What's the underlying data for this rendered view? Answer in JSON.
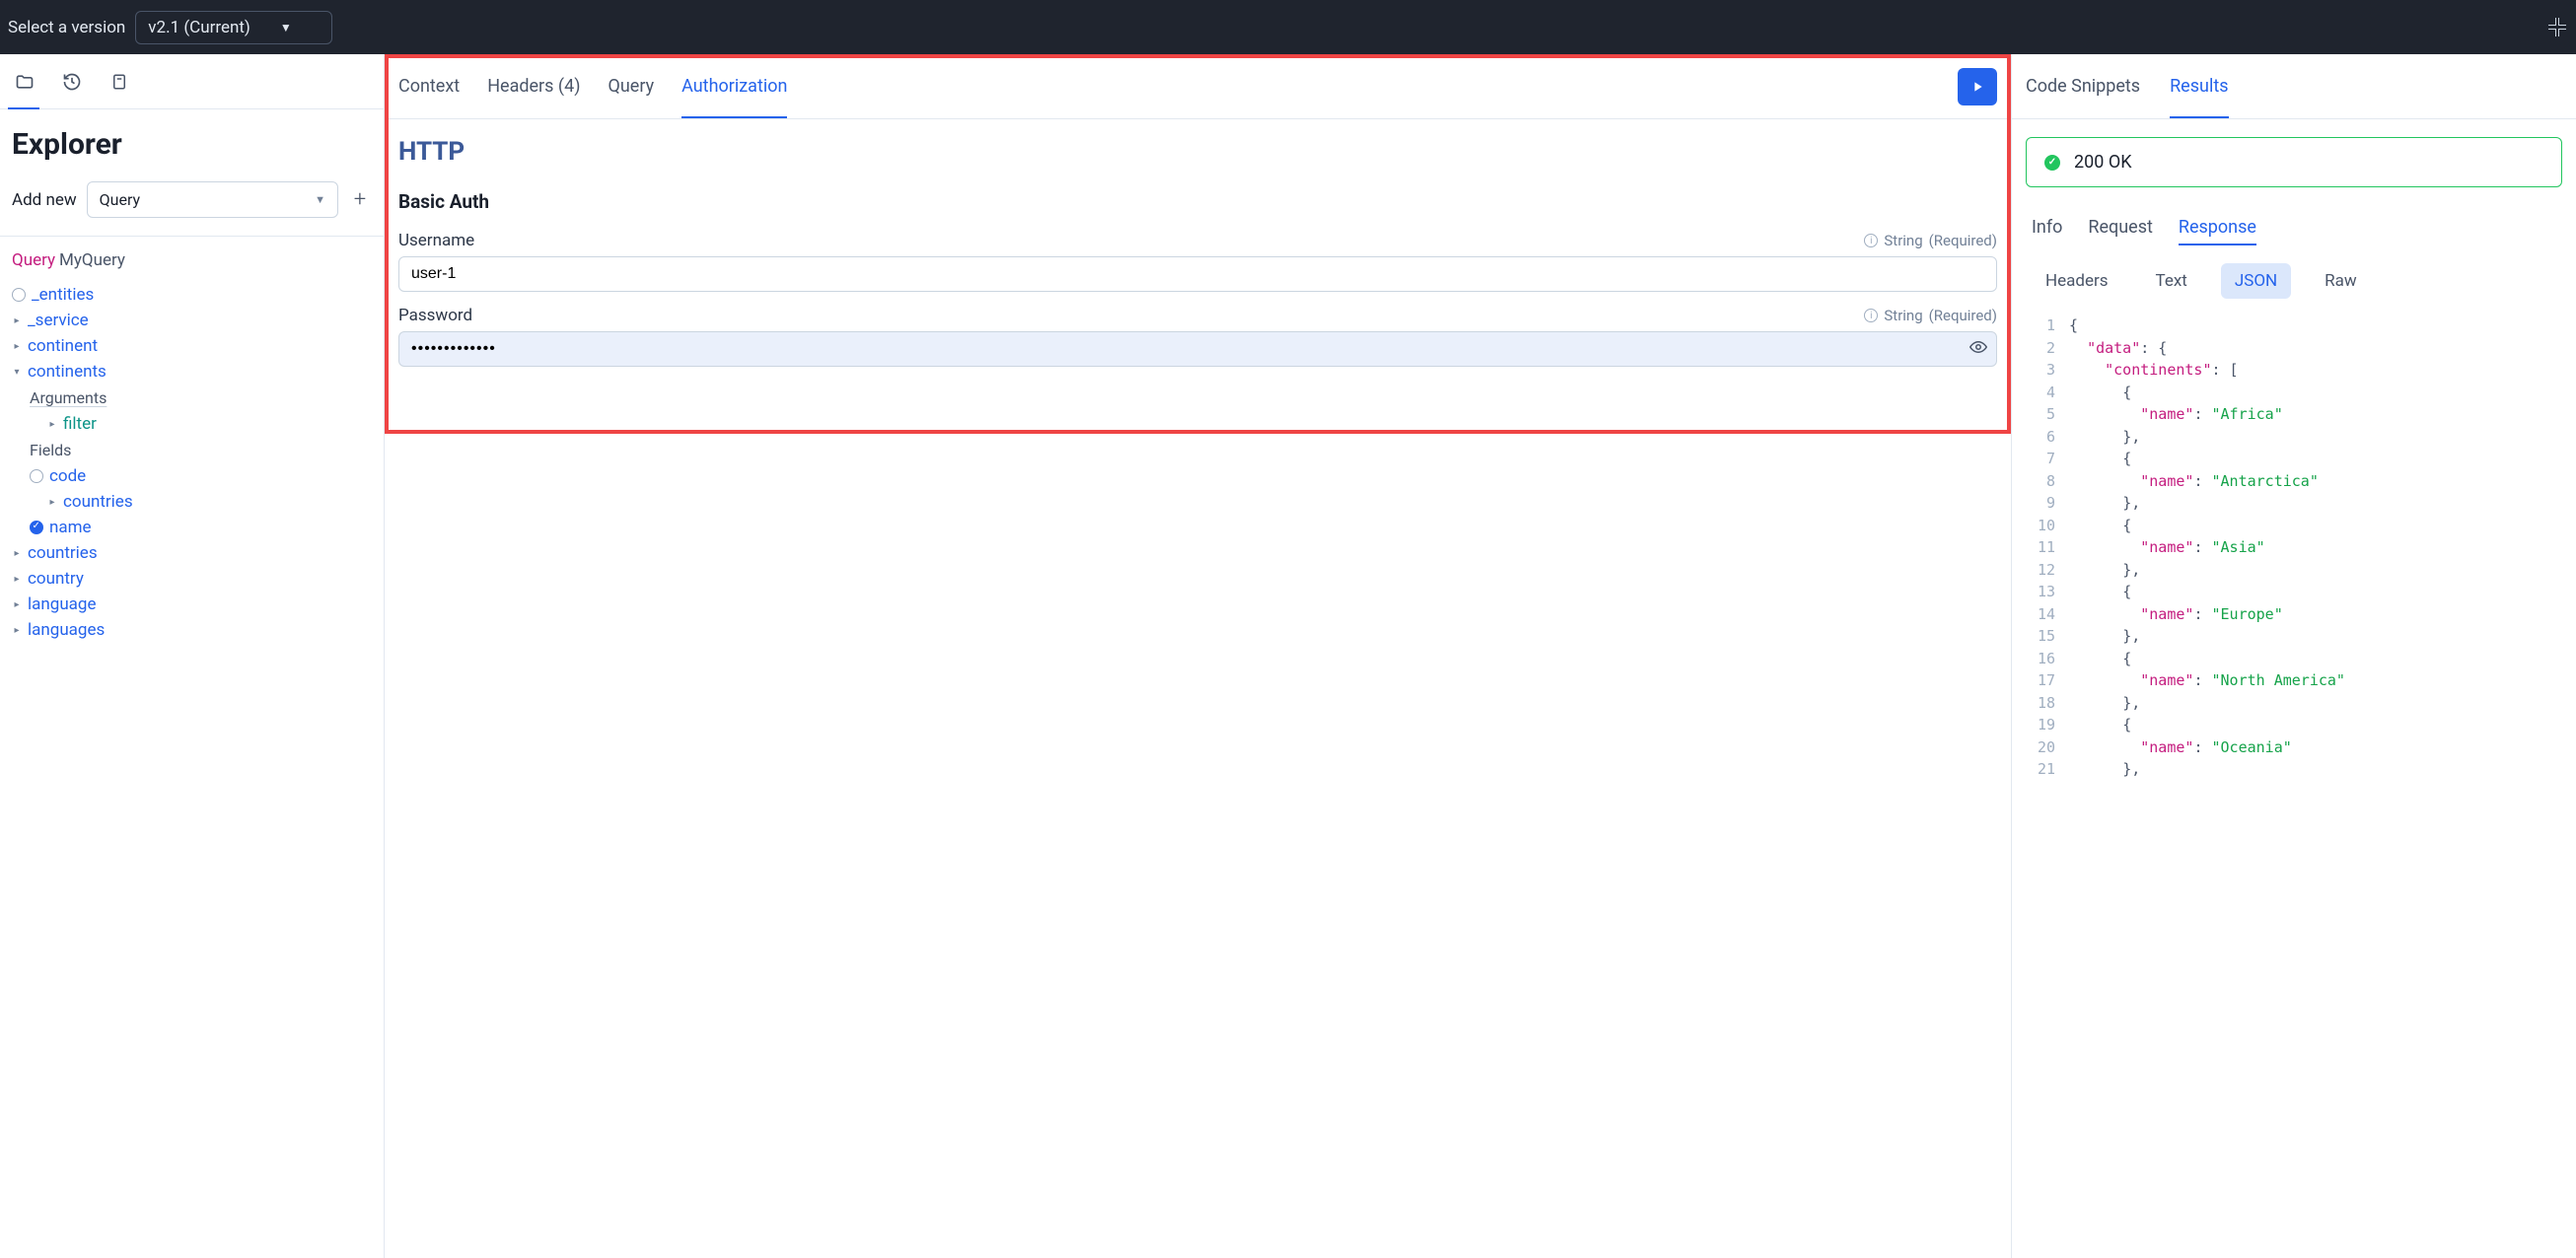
{
  "topbar": {
    "label": "Select a version",
    "version": "v2.1 (Current)"
  },
  "left": {
    "title": "Explorer",
    "addnew_label": "Add new",
    "addnew_value": "Query",
    "query_keyword": "Query",
    "query_name": "MyQuery",
    "tree": {
      "entities": "_entities",
      "service": "_service",
      "continent": "continent",
      "continents": "continents",
      "arguments": "Arguments",
      "filter": "filter",
      "fields": "Fields",
      "code": "code",
      "countries_field": "countries",
      "name": "name",
      "countries": "countries",
      "country": "country",
      "language": "language",
      "languages": "languages"
    }
  },
  "middle": {
    "tabs": {
      "context": "Context",
      "headers": "Headers (4)",
      "query": "Query",
      "auth": "Authorization"
    },
    "http_title": "HTTP",
    "auth_subtitle": "Basic Auth",
    "username_label": "Username",
    "username_value": "user-1",
    "password_label": "Password",
    "password_value": "•••••••••••••",
    "hint_type": "String",
    "hint_req": "(Required)"
  },
  "right": {
    "tabs": {
      "snippets": "Code Snippets",
      "results": "Results"
    },
    "status": "200 OK",
    "subtabs": {
      "info": "Info",
      "request": "Request",
      "response": "Response"
    },
    "formats": {
      "headers": "Headers",
      "text": "Text",
      "json": "JSON",
      "raw": "Raw"
    },
    "json_lines": [
      {
        "n": 1,
        "indent": 0,
        "tokens": [
          {
            "t": "punc",
            "v": "{"
          }
        ]
      },
      {
        "n": 2,
        "indent": 1,
        "tokens": [
          {
            "t": "key",
            "v": "\"data\""
          },
          {
            "t": "punc",
            "v": ": {"
          }
        ]
      },
      {
        "n": 3,
        "indent": 2,
        "tokens": [
          {
            "t": "key",
            "v": "\"continents\""
          },
          {
            "t": "punc",
            "v": ": ["
          }
        ]
      },
      {
        "n": 4,
        "indent": 3,
        "tokens": [
          {
            "t": "punc",
            "v": "{"
          }
        ]
      },
      {
        "n": 5,
        "indent": 4,
        "tokens": [
          {
            "t": "key",
            "v": "\"name\""
          },
          {
            "t": "punc",
            "v": ": "
          },
          {
            "t": "str",
            "v": "\"Africa\""
          }
        ]
      },
      {
        "n": 6,
        "indent": 3,
        "tokens": [
          {
            "t": "punc",
            "v": "},"
          }
        ]
      },
      {
        "n": 7,
        "indent": 3,
        "tokens": [
          {
            "t": "punc",
            "v": "{"
          }
        ]
      },
      {
        "n": 8,
        "indent": 4,
        "tokens": [
          {
            "t": "key",
            "v": "\"name\""
          },
          {
            "t": "punc",
            "v": ": "
          },
          {
            "t": "str",
            "v": "\"Antarctica\""
          }
        ]
      },
      {
        "n": 9,
        "indent": 3,
        "tokens": [
          {
            "t": "punc",
            "v": "},"
          }
        ]
      },
      {
        "n": 10,
        "indent": 3,
        "tokens": [
          {
            "t": "punc",
            "v": "{"
          }
        ]
      },
      {
        "n": 11,
        "indent": 4,
        "tokens": [
          {
            "t": "key",
            "v": "\"name\""
          },
          {
            "t": "punc",
            "v": ": "
          },
          {
            "t": "str",
            "v": "\"Asia\""
          }
        ]
      },
      {
        "n": 12,
        "indent": 3,
        "tokens": [
          {
            "t": "punc",
            "v": "},"
          }
        ]
      },
      {
        "n": 13,
        "indent": 3,
        "tokens": [
          {
            "t": "punc",
            "v": "{"
          }
        ]
      },
      {
        "n": 14,
        "indent": 4,
        "tokens": [
          {
            "t": "key",
            "v": "\"name\""
          },
          {
            "t": "punc",
            "v": ": "
          },
          {
            "t": "str",
            "v": "\"Europe\""
          }
        ]
      },
      {
        "n": 15,
        "indent": 3,
        "tokens": [
          {
            "t": "punc",
            "v": "},"
          }
        ]
      },
      {
        "n": 16,
        "indent": 3,
        "tokens": [
          {
            "t": "punc",
            "v": "{"
          }
        ]
      },
      {
        "n": 17,
        "indent": 4,
        "tokens": [
          {
            "t": "key",
            "v": "\"name\""
          },
          {
            "t": "punc",
            "v": ": "
          },
          {
            "t": "str",
            "v": "\"North America\""
          }
        ]
      },
      {
        "n": 18,
        "indent": 3,
        "tokens": [
          {
            "t": "punc",
            "v": "},"
          }
        ]
      },
      {
        "n": 19,
        "indent": 3,
        "tokens": [
          {
            "t": "punc",
            "v": "{"
          }
        ]
      },
      {
        "n": 20,
        "indent": 4,
        "tokens": [
          {
            "t": "key",
            "v": "\"name\""
          },
          {
            "t": "punc",
            "v": ": "
          },
          {
            "t": "str",
            "v": "\"Oceania\""
          }
        ]
      },
      {
        "n": 21,
        "indent": 3,
        "tokens": [
          {
            "t": "punc",
            "v": "},"
          }
        ]
      }
    ]
  }
}
